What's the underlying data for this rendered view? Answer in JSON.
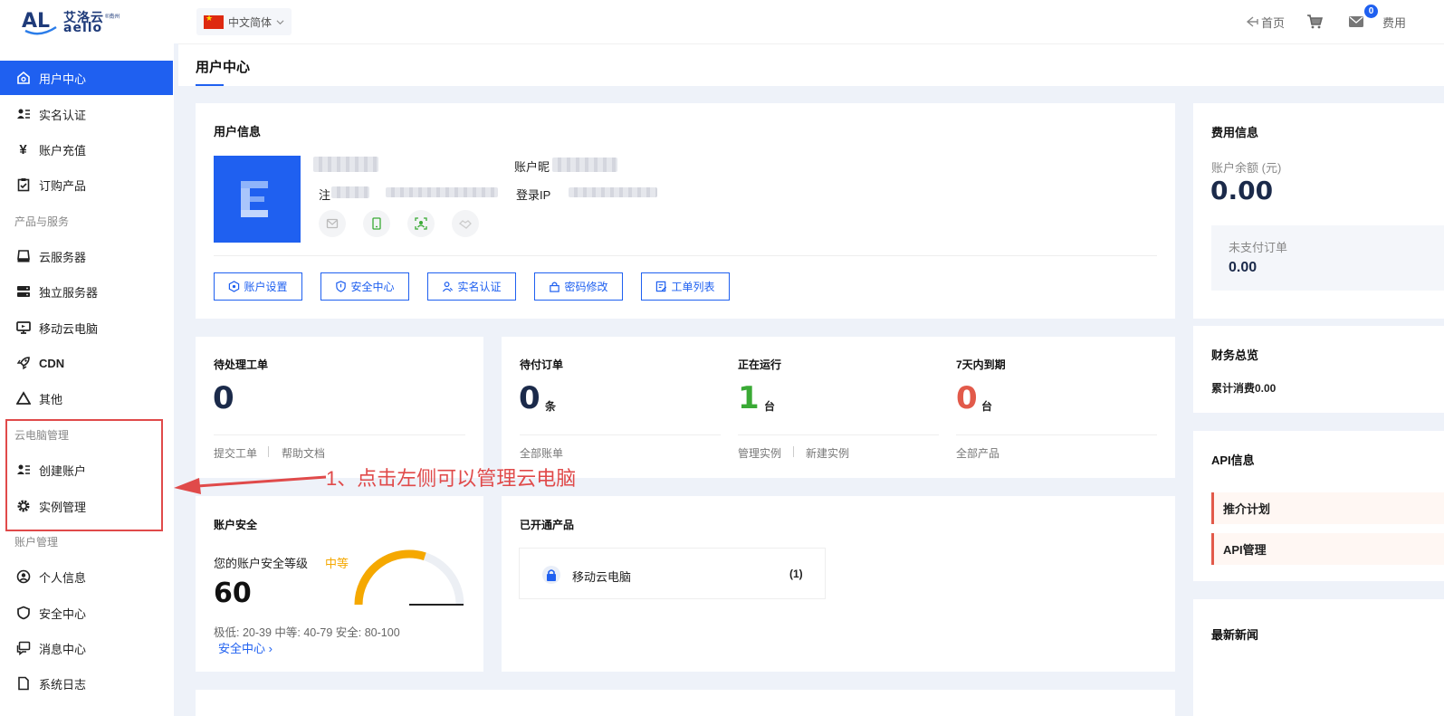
{
  "brand": {
    "name_cn": "艾洛云",
    "name_en": "aello",
    "tag": "®南州"
  },
  "header": {
    "language": "中文简体",
    "home": "首页",
    "mail_count": "0",
    "fee": "费用"
  },
  "sidebar": {
    "items_top": [
      {
        "label": "用户中心"
      },
      {
        "label": "实名认证"
      },
      {
        "label": "账户充值"
      },
      {
        "label": "订购产品"
      }
    ],
    "section_products": "产品与服务",
    "items_products": [
      {
        "label": "云服务器"
      },
      {
        "label": "独立服务器"
      },
      {
        "label": "移动云电脑"
      },
      {
        "label": "CDN"
      },
      {
        "label": "其他"
      }
    ],
    "section_cloudpc": "云电脑管理",
    "items_cloudpc": [
      {
        "label": "创建账户"
      },
      {
        "label": "实例管理"
      }
    ],
    "section_account": "账户管理",
    "items_account": [
      {
        "label": "个人信息"
      },
      {
        "label": "安全中心"
      },
      {
        "label": "消息中心"
      },
      {
        "label": "系统日志"
      }
    ]
  },
  "page": {
    "title": "用户中心"
  },
  "user_info": {
    "title": "用户信息",
    "nickname_label": "账户昵",
    "register_label": "注",
    "login_ip_label": "登录IP",
    "buttons": [
      {
        "label": "账户设置"
      },
      {
        "label": "安全中心"
      },
      {
        "label": "实名认证"
      },
      {
        "label": "密码修改"
      },
      {
        "label": "工单列表"
      }
    ]
  },
  "tickets": {
    "title": "待处理工单",
    "value": "0",
    "link_submit": "提交工单",
    "link_help": "帮助文档"
  },
  "orders": {
    "pending_title": "待付订单",
    "pending_value": "0",
    "pending_unit": "条",
    "pending_link": "全部账单",
    "running_title": "正在运行",
    "running_value": "1",
    "running_unit": "台",
    "running_link_manage": "管理实例",
    "running_link_new": "新建实例",
    "expiring_title": "7天内到期",
    "expiring_value": "0",
    "expiring_unit": "台",
    "expiring_link": "全部产品",
    "colors": {
      "running": "#3aaa35",
      "expiring": "#e25a4a"
    }
  },
  "security": {
    "title": "账户安全",
    "level_label": "您的账户安全等级",
    "level": "中等",
    "score": "60",
    "score_value": 60,
    "legend": "极低: 20-39 中等: 40-79 安全: 80-100",
    "link": "安全中心 ›",
    "gauge_color": "#f5a800"
  },
  "products": {
    "title": "已开通产品",
    "items": [
      {
        "name": "移动云电脑",
        "count": "(1)"
      }
    ]
  },
  "fees": {
    "title": "费用信息",
    "balance_label": "账户余额 (元)",
    "balance": "0.00",
    "unpaid_label": "未支付订单",
    "unpaid_value": "0.00"
  },
  "finance": {
    "title": "财务总览",
    "total_label": "累计消费0.00"
  },
  "api": {
    "title": "API信息",
    "links": [
      {
        "label": "推介计划"
      },
      {
        "label": "API管理"
      }
    ]
  },
  "news": {
    "title": "最新新闻"
  },
  "annotation": {
    "text": "1、点击左侧可以管理云电脑",
    "color": "#e04a4a"
  },
  "colors": {
    "primary": "#1f60f0",
    "background": "#eef2f9"
  }
}
